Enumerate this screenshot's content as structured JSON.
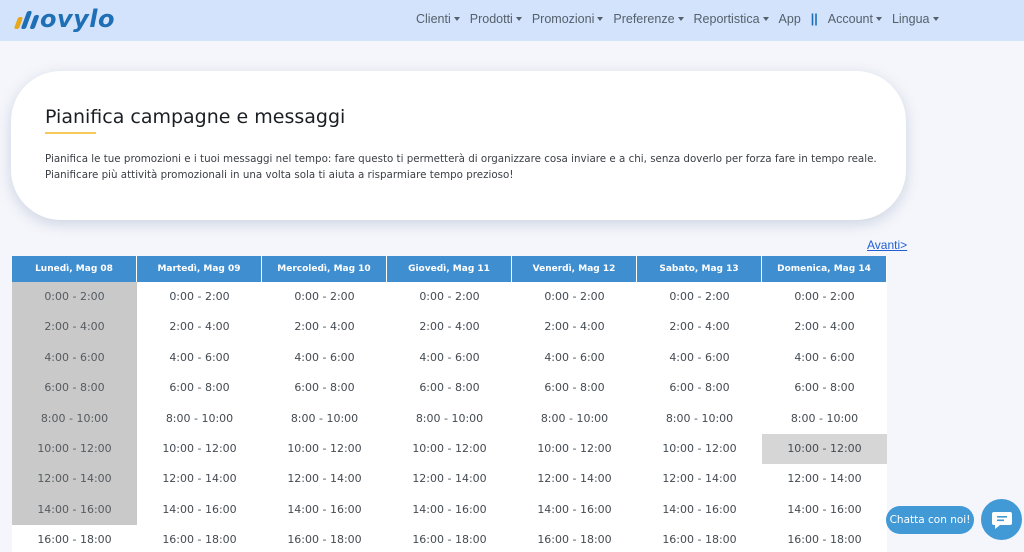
{
  "brand": {
    "name": "ovylo",
    "colors": {
      "primary": "#1e6fb5",
      "accent": "#e7a81a"
    }
  },
  "nav": {
    "items": [
      {
        "label": "Clienti",
        "dropdown": true
      },
      {
        "label": "Prodotti",
        "dropdown": true
      },
      {
        "label": "Promozioni",
        "dropdown": true
      },
      {
        "label": "Preferenze",
        "dropdown": true
      },
      {
        "label": "Reportistica",
        "dropdown": true
      },
      {
        "label": "App",
        "dropdown": false
      }
    ],
    "separator": "||",
    "items_right": [
      {
        "label": "Account",
        "dropdown": true
      },
      {
        "label": "Lingua",
        "dropdown": true
      }
    ]
  },
  "intro": {
    "title": "Pianifica campagne e messaggi",
    "description": "Pianifica le tue promozioni e i tuoi messaggi nel tempo: fare questo ti permetterà di organizzare cosa inviare e a chi, senza doverlo per forza fare in tempo reale. Pianificare più attività promozionali in una volta sola ti aiuta a risparmiare tempo prezioso!"
  },
  "pager": {
    "next_label": "Avanti>"
  },
  "calendar": {
    "header_color": "#3f8ed0",
    "slots": [
      "0:00 - 2:00",
      "2:00 - 4:00",
      "4:00 - 6:00",
      "6:00 - 8:00",
      "8:00 - 10:00",
      "10:00 - 12:00",
      "12:00 - 14:00",
      "14:00 - 16:00",
      "16:00 - 18:00"
    ],
    "days": [
      {
        "label": "Lunedì, Mag 08",
        "past_slots": 8,
        "selected_slot": -1
      },
      {
        "label": "Martedì, Mag 09",
        "past_slots": 0,
        "selected_slot": -1
      },
      {
        "label": "Mercoledì, Mag 10",
        "past_slots": 0,
        "selected_slot": -1
      },
      {
        "label": "Giovedì, Mag 11",
        "past_slots": 0,
        "selected_slot": -1
      },
      {
        "label": "Venerdì, Mag 12",
        "past_slots": 0,
        "selected_slot": -1
      },
      {
        "label": "Sabato, Mag 13",
        "past_slots": 0,
        "selected_slot": -1
      },
      {
        "label": "Domenica, Mag 14",
        "past_slots": 0,
        "selected_slot": 5
      }
    ]
  },
  "chat": {
    "label": "Chatta con noi!",
    "icon": "chat-icon"
  }
}
